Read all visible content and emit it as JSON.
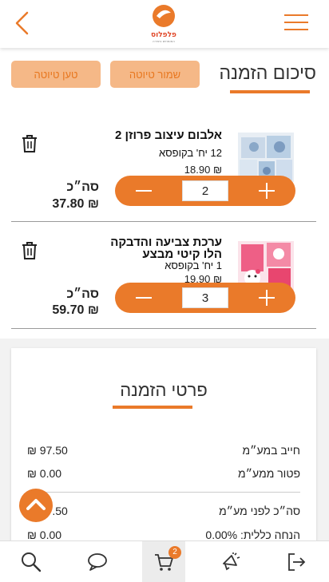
{
  "header": {
    "logo_text": "פלפלוס",
    "logo_subtext": "המומחים ביצירה"
  },
  "main": {
    "page_title": "סיכום הזמנה",
    "save_draft_label": "שמור טיוטה",
    "load_draft_label": "טען טיוטה"
  },
  "cart": {
    "items": [
      {
        "name": "אלבום עיצוב פרוזן 2",
        "pack": "12 יח' בקופסא",
        "price": "₪ 18.90",
        "quantity": "2",
        "total_label": "סה״כ",
        "total_value": "₪ 37.80"
      },
      {
        "name": "ערכת צביעה והדבקה הלו קיטי מבצע",
        "pack": "1 יח' בקופסא",
        "price": "₪ 19.90",
        "quantity": "3",
        "total_label": "סה״כ",
        "total_value": "₪ 59.70"
      }
    ]
  },
  "order_details": {
    "title": "פרטי הזמנה",
    "rows": [
      {
        "label": "חייב במע״מ",
        "value": "₪ 97.50"
      },
      {
        "label": "פטור ממע״מ",
        "value": "₪ 0.00"
      },
      {
        "label": "סה״כ לפני מע״מ",
        "value": "₪ 97.50"
      },
      {
        "label": "הנחה כללית: 0.00%",
        "value": "₪ 0.00"
      }
    ]
  },
  "nav": {
    "cart_count": "2"
  },
  "colors": {
    "accent": "#ea7a2a",
    "draft_button_bg": "#f5b887",
    "active_nav_bg": "#ececec"
  },
  "icons": [
    "back-arrow-icon",
    "menu-icon",
    "trash-icon",
    "minus-icon",
    "plus-icon",
    "chevron-up-icon",
    "search-icon",
    "chat-icon",
    "cart-icon",
    "megaphone-icon",
    "logout-icon"
  ]
}
